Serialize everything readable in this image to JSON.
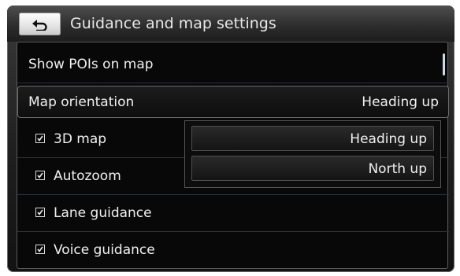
{
  "header": {
    "title": "Guidance and map settings",
    "back_icon": "back-arrow-icon"
  },
  "rows": [
    {
      "label": "Show POIs on map"
    },
    {
      "label": "Map orientation",
      "value": "Heading up"
    },
    {
      "label": "3D map",
      "checked": true
    },
    {
      "label": "Autozoom",
      "checked": true
    },
    {
      "label": "Lane guidance",
      "checked": true
    },
    {
      "label": "Voice guidance",
      "checked": true
    }
  ],
  "dropdown": {
    "options": [
      "Heading up",
      "North up"
    ]
  },
  "colors": {
    "background": "#080808",
    "text": "#f0f0f0",
    "scrollbar": "#cfd8e6"
  }
}
